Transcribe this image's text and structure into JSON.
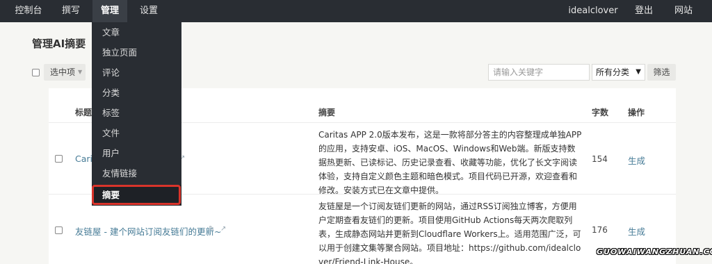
{
  "nav": {
    "dashboard": "控制台",
    "write": "撰写",
    "manage": "管理",
    "settings": "设置",
    "user": "idealclover",
    "logout": "登出",
    "site": "网站"
  },
  "dropdown": {
    "items": [
      "文章",
      "独立页面",
      "评论",
      "分类",
      "标签",
      "文件",
      "用户",
      "友情链接",
      "摘要"
    ]
  },
  "page_title": "管理AI摘要",
  "toolbar": {
    "selected_label": "选中项",
    "search_placeholder": "请输入关键字",
    "category_value": "所有分类",
    "filter_label": "筛选"
  },
  "table": {
    "headers": {
      "title": "标题",
      "summary": "摘要",
      "chars": "字数",
      "action": "操作"
    },
    "rows": [
      {
        "title": "Carit",
        "summary": "Caritas APP 2.0版本发布，这是一款将部分答主的内容整理成单独APP的应用，支持安卓、iOS、MacOS、Windows和Web端。新版支持数据热更新、已读标记、历史记录查看、收藏等功能，优化了长文字阅读体验，支持自定义颜色主题和暗色模式。项目代码已开源，欢迎查看和修改。安装方式已在文章中提供。",
        "chars": "154",
        "action": "生成"
      },
      {
        "title": "友链屋 - 建个网站订阅友链们的更新~",
        "summary": "友链屋是一个订阅友链们更新的网站，通过RSS订阅独立博客，方便用户定期查看友链们的更新。项目使用GitHub Actions每天两次爬取列表，生成静态网站并更新到Cloudflare Workers上。适用范围广泛，可以用于创建文集等聚合网站。项目地址：https://github.com/idealclover/Friend-Link-House。",
        "chars": "176",
        "action": "生成"
      }
    ]
  },
  "watermark": "GUOWAIWANGZHUAN.COM"
}
